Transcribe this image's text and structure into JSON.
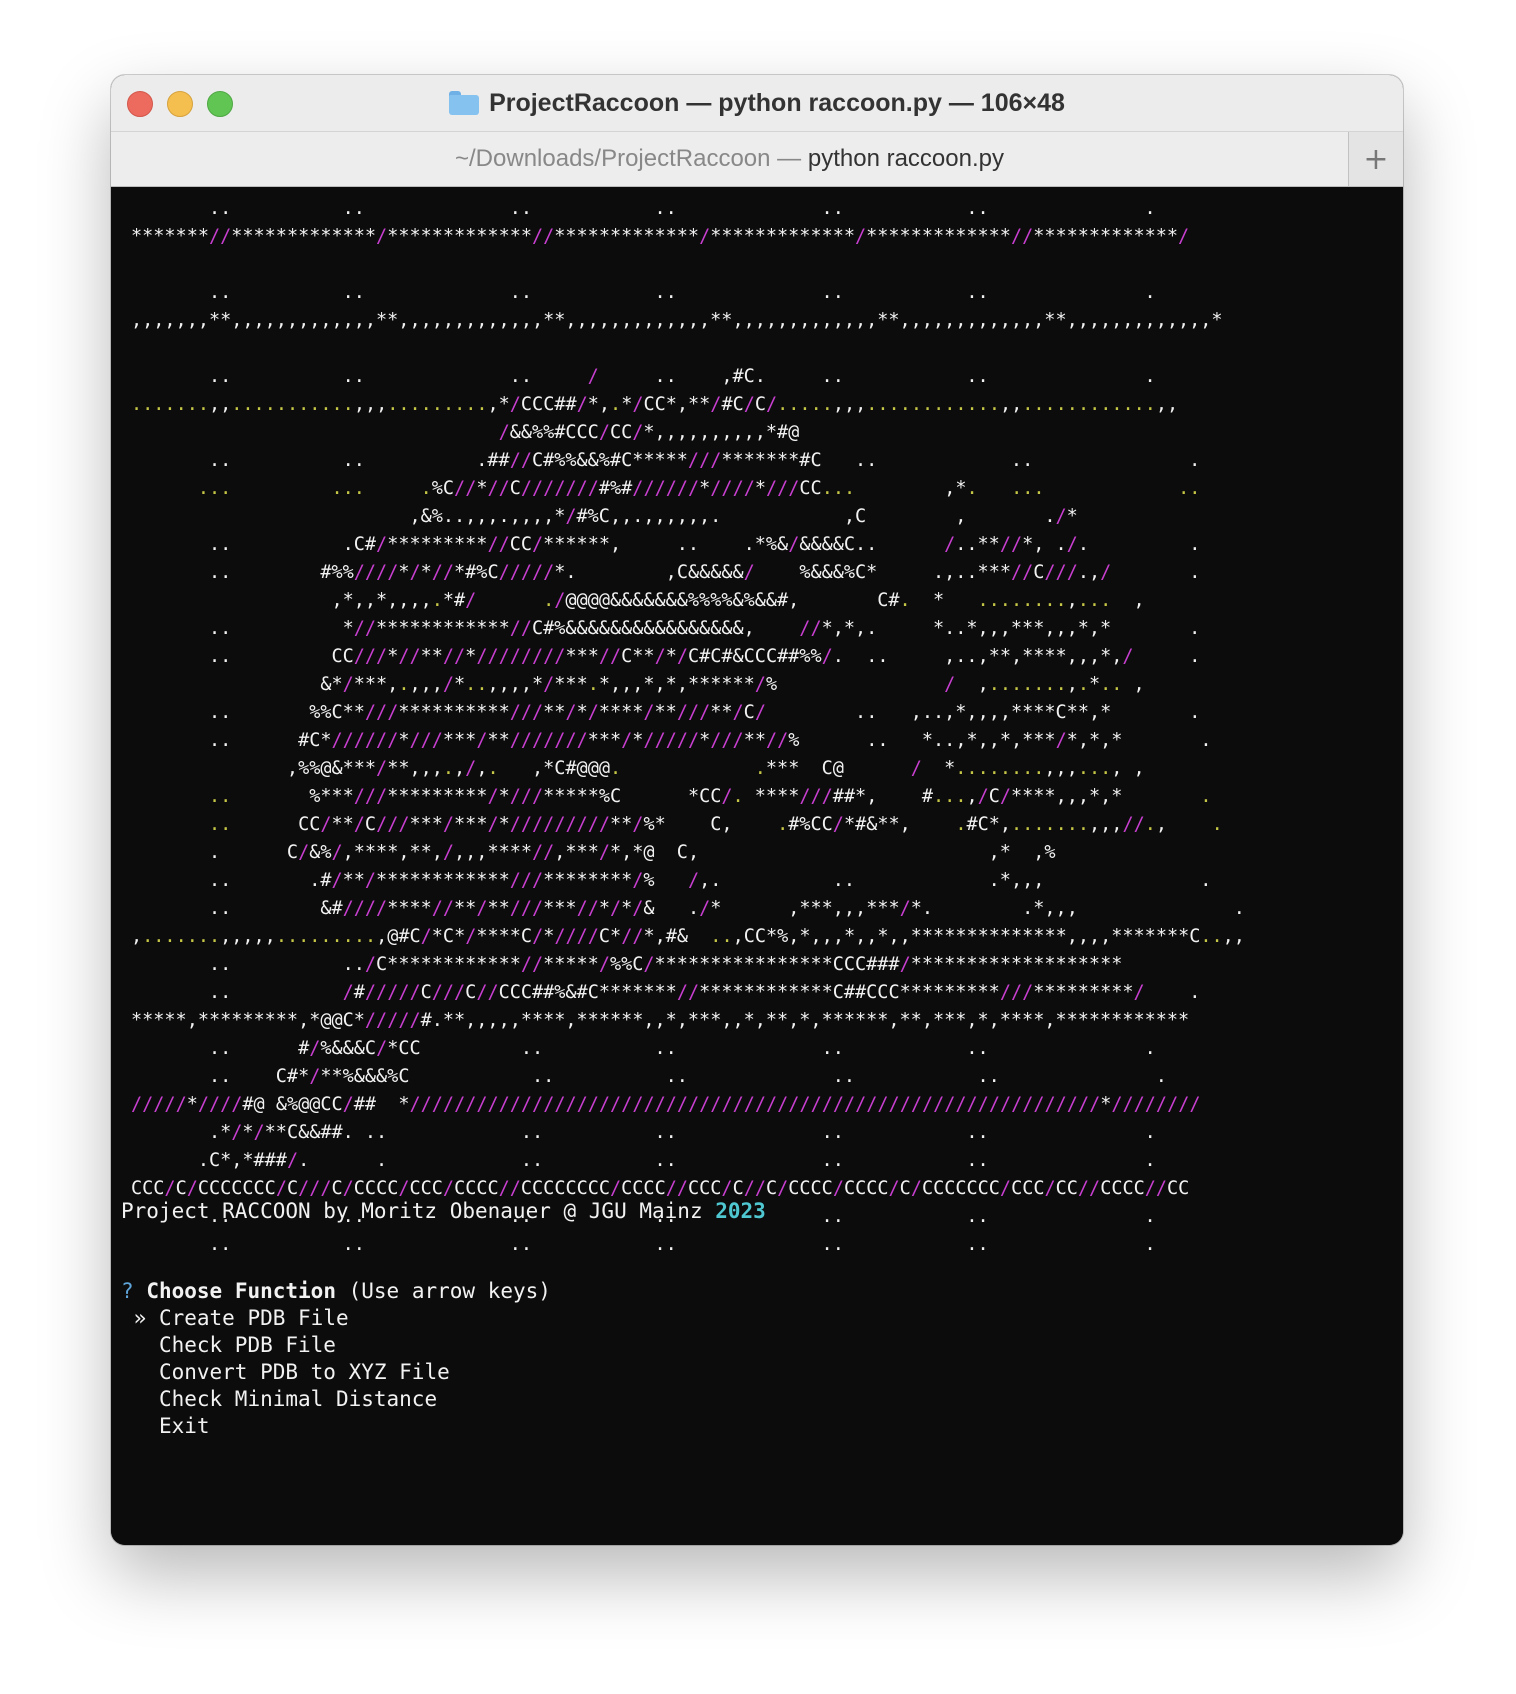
{
  "window": {
    "title": "ProjectRaccoon — python raccoon.py — 106×48",
    "tab": {
      "path": "~/Downloads/ProjectRaccoon",
      "separator": " — ",
      "command": "python raccoon.py"
    },
    "new_tab_label": "+"
  },
  "colors": {
    "white": "#f2f2f2",
    "magenta": "#c83fd0",
    "olive": "#c6c647",
    "cyan": "#4fc7d1",
    "prompt_blue": "#5fa5d9"
  },
  "icons": {
    "folder": "folder-icon",
    "close": "close-button",
    "minimize": "minimize-button",
    "zoom": "zoom-button",
    "add": "plus-icon"
  },
  "ascii_art": [
    "       ..          ..             ..           ..             ..           ..              .",
    "*******//*************/*************//*************/*************/*************//*************/",
    "",
    "       ..          ..             ..           ..             ..           ..              .",
    ",,,,,,,**,,,,,,,,,,,,,**,,,,,,,,,,,,,**,,,,,,,,,,,,,**,,,,,,,,,,,,,**,,,,,,,,,,,,,**,,,,,,,,,,,,,*",
    "",
    "       ..          ..             ..     /     ..    ,#C.     ..           ..              .",
    ".......,,...........,,,.........,*/CCC##/*,.*/CC*,**/#C/C/.....,,,............,,............,,",
    "                                 /&&%%#CCC/CC/*,,,,,,,,,,*#@",
    "       ..          ..          .##//C#%%&&%#C*****///*******#C   ..            ..              .",
    "      ...         ...     .%C//*//C///////#%#//////*////*///CC...        ,*.   ...            ..",
    "                         ,&%..,,,.,,,,*/#%C,,.,,,,,,.           ,C        ,       ./*",
    "       ..          .C#/*********//CC/******,     ..    .*%&/&&&&C..      /..**//*, ./.         .",
    "       ..        #%%////*/*//*#%C/////*.        ,C&&&&&/    %&&&%C*     .,..***//C///.,/       .",
    "                  ,*,,*,,,,.*#/      ./@@@@&&&&&&&%%%%&%&&#,       C#.  *   ........,...  ,",
    "       ..          *//************//C#%&&&&&&&&&&&&&&&&,    //*,*,.     *..*,,,***,,,*,*       .",
    "       ..         CC///*//**//*////////***//C**/*/C#C#&CCC##%%/.  ..     ,..,**,****,,,*,/     .",
    "                 &*/***,.,,,/*..,,,,*/***.*,,,*,*,******/%               /  ,.......,.*.. ,",
    "       ..       %%C**///**********///**/*/****/**///**/C/        ..   ,..,*,,,,****C**,*       .",
    "       ..      #C*//////*///***/**///////***/*/////*///**//%      ..   *..,*,,*,***/*,*,*       .",
    "              ,%%@&***/**,,,.,/,.   ,*C#@@@.            .***  C@      /  *........,,,..., ,",
    "       ..       %***///*********/*///*****%C      *CC/. ****///##*,    #...,/C/****,,,*,*       .",
    "       ..      CC/**/C///***/***/*/////////**/%*    C,    .#%CC/*#&**,    .#C*,.......,,,//.,    .",
    "       .      C/&%/,****,**,/,,,****//,***/*,*@  C,                          ,*  ,%",
    "       ..       .#/**/************///********/%   /,.          ..            .*,,,              .",
    "       ..        &#////****//**/**///***//*/*/&   ./*      ,***,,,***/*.        .*,,,              .",
    ",.......,,,,,.........,@#C/*C*/****C/*////C*//*,#&  ..,CC*%,*,,,*,,*,,**************,,,,*******C..,,",
    "       ..          ../C************//*****/%%C/****************CCC###/*******************",
    "       ..          /#/////C///C//CCC##%&#C*******//************C##CCC*********///*********/    .",
    "*****,*********,*@@C*/////#.**,,,,,****,******,,*,***,,*,**,*,******,**,***,*,****,************",
    "       ..      #/%&&&C/*CC         ..          ..             ..           ..              .",
    "       ..    C#*/**%&&&%C           ..          ..             ..           ..              .",
    "/////*////#@ &%@@CC/##  *//////////////////////////////////////////////////////////////*////////",
    "       .*/*/**C&&##. ..            ..          ..             ..           ..              .",
    "      .C*,*###/.      .            ..          ..             ..           ..              .",
    "CCC/C/CCCCCCC/C///C/CCCC/CCC/CCCC//CCCCCCCC/CCCC//CCC/C//C/CCCC/CCCC/C/CCCCCCC/CCC/CC//CCCC//CC",
    "       ..          ..             ..           ..             ..           ..              .",
    "       ..          ..             ..           ..             ..           ..              ."
  ],
  "banner": {
    "prefix": "Project RACCOON by Moritz Obenauer @ JGU Mainz ",
    "year": "2023"
  },
  "prompt": {
    "marker": "?",
    "question": "Choose Function",
    "hint": "(Use arrow keys)",
    "selector": "»",
    "options": [
      "Create PDB File",
      "Check PDB File",
      "Convert PDB to XYZ File",
      "Check Minimal Distance",
      "Exit"
    ],
    "selected_index": 0
  }
}
